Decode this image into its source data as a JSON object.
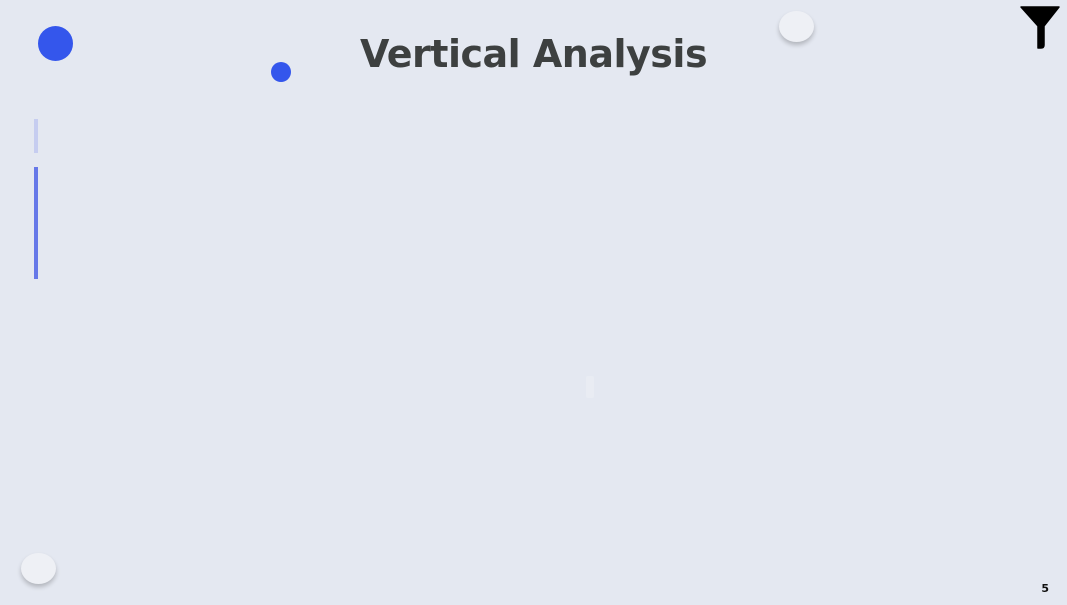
{
  "slide": {
    "title": "Vertical Analysis",
    "page_number": "5"
  },
  "icons": {
    "filter": "filter-icon"
  },
  "colors": {
    "background": "#e4e8f1",
    "accent_blue": "#3456ec",
    "accent_bar_light": "#c6cdf0",
    "accent_bar_dark": "#6678e8",
    "title_text": "#3d4040"
  }
}
